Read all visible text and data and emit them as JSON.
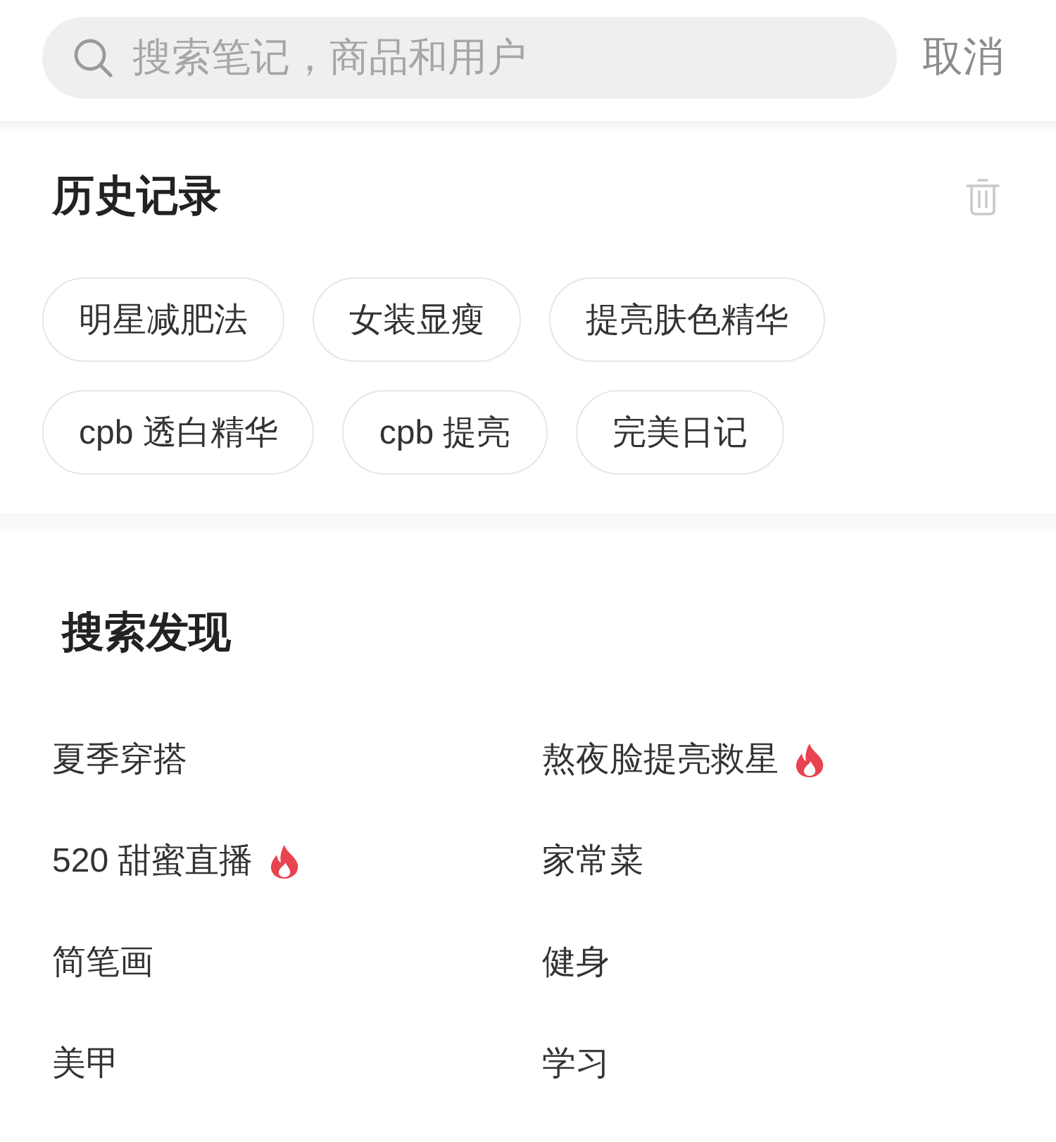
{
  "search": {
    "placeholder": "搜索笔记，商品和用户",
    "cancel": "取消"
  },
  "history": {
    "title": "历史记录",
    "items": [
      "明星减肥法",
      "女装显瘦",
      "提亮肤色精华",
      "cpb 透白精华",
      "cpb 提亮",
      "完美日记"
    ]
  },
  "discover": {
    "title": "搜索发现",
    "items": [
      {
        "label": "夏季穿搭",
        "hot": false
      },
      {
        "label": "熬夜脸提亮救星",
        "hot": true
      },
      {
        "label": "520 甜蜜直播",
        "hot": true
      },
      {
        "label": "家常菜",
        "hot": false
      },
      {
        "label": "简笔画",
        "hot": false
      },
      {
        "label": "健身",
        "hot": false
      },
      {
        "label": "美甲",
        "hot": false
      },
      {
        "label": "学习",
        "hot": false
      }
    ]
  }
}
